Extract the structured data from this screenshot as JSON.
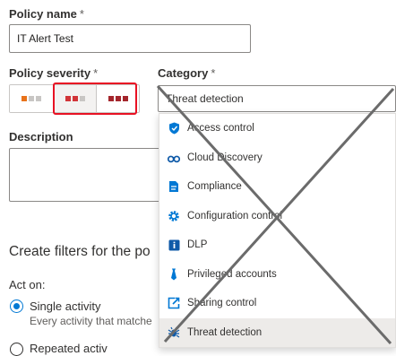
{
  "policy_name": {
    "label": "Policy name",
    "required_mark": "*",
    "value": "IT Alert Test"
  },
  "policy_severity": {
    "label": "Policy severity",
    "required_mark": "*",
    "levels": [
      {
        "name": "low",
        "colors": [
          "#e8731b",
          "#c8c6c4",
          "#c8c6c4"
        ]
      },
      {
        "name": "medium",
        "colors": [
          "#d13438",
          "#d13438",
          "#c8c6c4"
        ],
        "selected": true
      },
      {
        "name": "high",
        "colors": [
          "#a4262c",
          "#a4262c",
          "#a4262c"
        ]
      }
    ]
  },
  "category": {
    "label": "Category",
    "required_mark": "*",
    "selected": "Threat detection",
    "options": [
      {
        "label": "Access control",
        "icon": "shield-icon"
      },
      {
        "label": "Cloud Discovery",
        "icon": "binoculars-icon"
      },
      {
        "label": "Compliance",
        "icon": "compliance-icon"
      },
      {
        "label": "Configuration control",
        "icon": "gear-icon"
      },
      {
        "label": "DLP",
        "icon": "info-icon"
      },
      {
        "label": "Privileged accounts",
        "icon": "tie-icon"
      },
      {
        "label": "Sharing control",
        "icon": "share-icon"
      },
      {
        "label": "Threat detection",
        "icon": "bug-icon",
        "selected": true
      }
    ]
  },
  "description": {
    "label": "Description",
    "value": ""
  },
  "filters": {
    "title": "Create filters for the po",
    "act_on_label": "Act on:",
    "single_activity": {
      "label": "Single activity",
      "description": "Every activity that matche"
    },
    "repeated_activity": {
      "label": "Repeated activ"
    }
  },
  "colors": {
    "accent": "#0078d4",
    "annotation_red": "#e81123",
    "cross": "#6b6b6b"
  }
}
